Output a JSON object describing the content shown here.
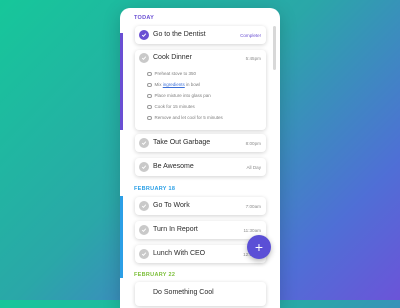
{
  "sections": {
    "today": "TODAY",
    "feb18": "FEBRUARY 18",
    "feb22": "FEBRUARY 22"
  },
  "colors": {
    "today": "#6a4fd3",
    "feb18": "#2b9fe6",
    "feb22": "#7cbf3a"
  },
  "today_tasks": [
    {
      "title": "Go to the Dentist",
      "time": "Complete!",
      "checked": true
    },
    {
      "title": "Cook Dinner",
      "time": "5:45pm",
      "checked": false,
      "subtasks": [
        {
          "pre": "Preheat stove to 350",
          "link": "",
          "post": ""
        },
        {
          "pre": "Mix ",
          "link": "ingredients",
          "post": " in bowl"
        },
        {
          "pre": "Place mixture into glass pan",
          "link": "",
          "post": ""
        },
        {
          "pre": "Cook for 15 minutes",
          "link": "",
          "post": ""
        },
        {
          "pre": "Remove and let cool for 5 minutes",
          "link": "",
          "post": ""
        }
      ]
    },
    {
      "title": "Take Out Garbage",
      "time": "8:00pm",
      "checked": false
    },
    {
      "title": "Be Awesome",
      "time": "All Day",
      "checked": false
    }
  ],
  "feb18_tasks": [
    {
      "title": "Go To Work",
      "time": "7:00am"
    },
    {
      "title": "Turn In Report",
      "time": "11:30am"
    },
    {
      "title": "Lunch With CEO",
      "time": "12:00pm"
    }
  ],
  "feb22_tasks": [
    {
      "title": "Do Something Cool",
      "time": ""
    }
  ],
  "fab_label": "+"
}
